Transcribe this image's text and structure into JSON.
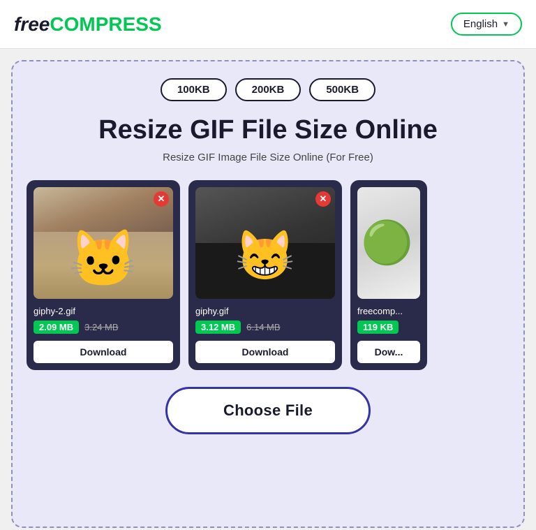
{
  "header": {
    "logo_free": "free",
    "logo_compress": "COMPRESS",
    "lang_button": "English",
    "lang_arrow": "▼"
  },
  "size_presets": [
    "100KB",
    "200KB",
    "500KB"
  ],
  "page_title": "Resize GIF File Size Online",
  "page_subtitle": "Resize GIF Image File Size Online (For Free)",
  "files": [
    {
      "name": "giphy-2.gif",
      "new_size": "2.09 MB",
      "old_size": "3.24 MB",
      "download_label": "Download",
      "image_type": "cat1"
    },
    {
      "name": "giphy.gif",
      "new_size": "3.12 MB",
      "old_size": "6.14 MB",
      "download_label": "Download",
      "image_type": "cat2"
    },
    {
      "name": "freecomp...",
      "new_size": "119 KB",
      "old_size": "",
      "download_label": "Dow...",
      "image_type": "cat3"
    }
  ],
  "choose_file_label": "Choose File"
}
